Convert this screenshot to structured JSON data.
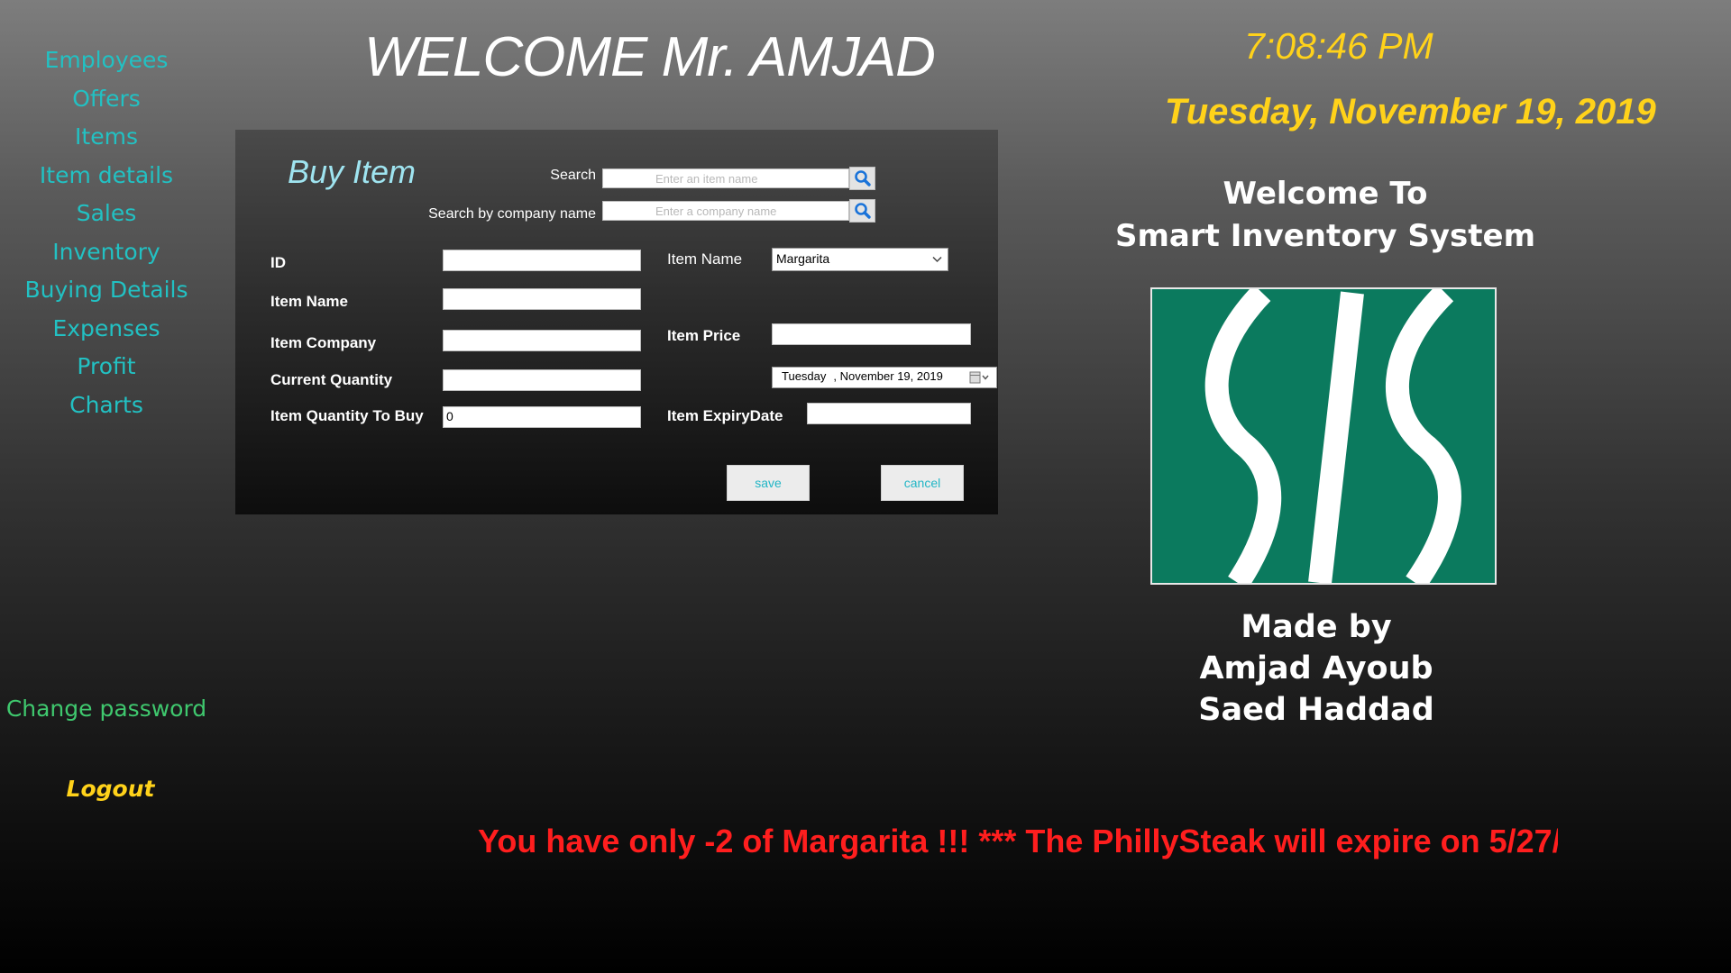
{
  "nav": {
    "items": [
      "Employees",
      "Offers",
      "Items",
      "Item details",
      "Sales",
      "Inventory",
      "Buying Details",
      "Expenses",
      "Profit",
      "Charts"
    ],
    "change_password": "Change password",
    "logout": "Logout"
  },
  "header": {
    "welcome": "WELCOME Mr. AMJAD",
    "time": "7:08:46 PM",
    "date": "Tuesday, November 19, 2019"
  },
  "info": {
    "welcome_line1": "Welcome To",
    "welcome_line2": "Smart Inventory System",
    "made_by": "Made by",
    "author1": "Amjad Ayoub",
    "author2": "Saed Haddad"
  },
  "form": {
    "title": "Buy Item",
    "search_label": "Search",
    "search_placeholder": "Enter an item name",
    "company_search_label": "Search by company name",
    "company_search_placeholder": "Enter a company name",
    "labels": {
      "id": "ID",
      "item_name": "Item Name",
      "item_company": "Item Company",
      "current_quantity": "Current Quantity",
      "quantity_to_buy": "Item Quantity To Buy",
      "item_name_select": "Item Name",
      "item_price": "Item Price",
      "expiry_date": "Item ExpiryDate"
    },
    "values": {
      "id": "",
      "item_name": "",
      "item_company": "",
      "current_quantity": "",
      "quantity_to_buy": "0",
      "item_name_select": "Margarita",
      "item_price": "",
      "date_day": "Tuesday",
      "date_rest": ", November 19, 2019",
      "expiry_date": ""
    },
    "save": "save",
    "cancel": "cancel"
  },
  "ticker": "You have only -2 of Margarita !!!    ***    The PhillySteak will expire on 5/27/",
  "colors": {
    "nav_text": "#22c1c3",
    "clock": "#ffd21a",
    "alert": "#ff1e1e",
    "logo_bg": "#0b7a5e"
  }
}
